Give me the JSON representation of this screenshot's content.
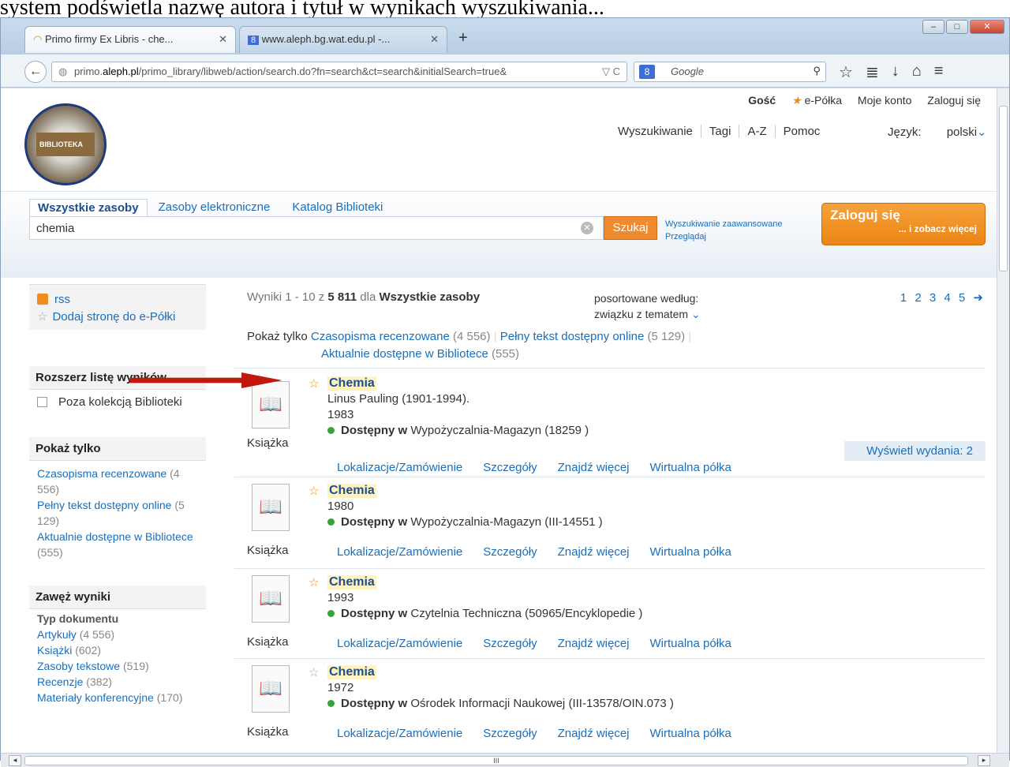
{
  "caption_top": "system podświetla nazwę autora i tytuł w wynikach wyszukiwania...",
  "browser": {
    "tab1": "Primo firmy Ex Libris - che...",
    "tab2": "www.aleph.bg.wat.edu.pl -...",
    "url_prefix": "primo.",
    "url_domain": "aleph.pl",
    "url_rest": "/primo_library/libweb/action/search.do?fn=search&ct=search&initialSearch=true&",
    "search_placeholder": "Google"
  },
  "header": {
    "user_links": [
      "Gość",
      "e-Półka",
      "Moje konto",
      "Zaloguj się"
    ],
    "nav": [
      "Wyszukiwanie",
      "Tagi",
      "A-Z",
      "Pomoc"
    ],
    "lang_label": "Język:",
    "lang_value": "polski",
    "logo_text": "BIBLIOTEKA"
  },
  "search": {
    "tabs": [
      "Wszystkie zasoby",
      "Zasoby elektroniczne",
      "Katalog Biblioteki"
    ],
    "query": "chemia",
    "button": "Szukaj",
    "advanced": "Wyszukiwanie zaawansowane",
    "browse": "Przeglądaj",
    "login_title": "Zaloguj się",
    "login_sub": "... i zobacz więcej"
  },
  "sidebar": {
    "rss": "rss",
    "add_shelf": "Dodaj stronę do e-Półki",
    "expand_title": "Rozszerz listę wyników",
    "outside_collection": "Poza kolekcją Biblioteki",
    "show_only_title": "Pokaż tylko",
    "show_only": [
      {
        "label": "Czasopisma recenzowane",
        "count": "(4 556)"
      },
      {
        "label": "Pełny tekst dostępny online",
        "count": "(5 129)"
      },
      {
        "label": "Aktualnie dostępne w Bibliotece",
        "count": "(555)"
      }
    ],
    "narrow_title": "Zawęż wyniki",
    "doc_type_title": "Typ dokumentu",
    "doc_types": [
      {
        "label": "Artykuły",
        "count": "(4 556)"
      },
      {
        "label": "Książki",
        "count": "(602)"
      },
      {
        "label": "Zasoby tekstowe",
        "count": "(519)"
      },
      {
        "label": "Recenzje",
        "count": "(382)"
      },
      {
        "label": "Materiały konferencyjne",
        "count": "(170)"
      }
    ]
  },
  "results": {
    "summary_prefix": "Wyniki 1 - 10 z",
    "total": "5 811",
    "summary_for": "dla",
    "scope": "Wszystkie zasoby",
    "sort_label": "posortowane według:",
    "sort_value": "związku z tematem",
    "pages": "1 2 3 4 5",
    "show_only_label": "Pokaż tylko",
    "filters": [
      {
        "label": "Czasopisma recenzowane",
        "count": "(4 556)"
      },
      {
        "label": "Pełny tekst dostępny online",
        "count": "(5 129)"
      },
      {
        "label": "Aktualnie dostępne w Bibliotece",
        "count": "(555)"
      }
    ],
    "action_links": [
      "Lokalizacje/Zamówienie",
      "Szczegóły",
      "Znajdź więcej",
      "Wirtualna półka"
    ],
    "available_label": "Dostępny w",
    "editions": "Wyświetl wydania: 2",
    "items": [
      {
        "title": "Chemia",
        "author": "Linus Pauling (1901-1994).",
        "year": "1983",
        "location": "Wypożyczalnia-Magazyn",
        "signature": "(18259 )",
        "type": "Książka"
      },
      {
        "title": "Chemia",
        "year": "1980",
        "location": "Wypożyczalnia-Magazyn",
        "signature": "(III-14551 )",
        "type": "Książka"
      },
      {
        "title": "Chemia",
        "year": "1993",
        "location": "Czytelnia Techniczna",
        "signature": "(50965/Encyklopedie )",
        "type": "Książka"
      },
      {
        "title": "Chemia",
        "year": "1972",
        "location": "Ośrodek Informacji Naukowej",
        "signature": "(III-13578/OIN.073 )",
        "type": "Książka"
      }
    ]
  },
  "colors": {
    "accent": "#1a6fba",
    "brand_orange": "#f08a2e",
    "available": "#39a339",
    "arrow": "#c0180c"
  }
}
